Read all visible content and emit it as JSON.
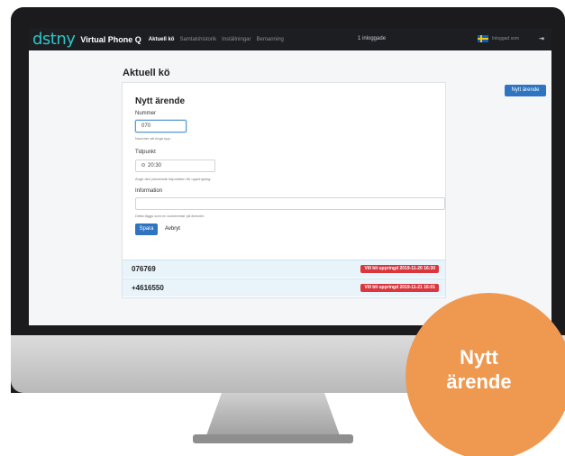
{
  "navbar": {
    "logo": "dstny",
    "product": "Virtual Phone Q",
    "tabs": [
      "Aktuell kö",
      "Samtalshistorik",
      "Inställningar",
      "Bemanning"
    ],
    "logged_in_count": "1 inloggade",
    "logged_in_as": "Inloggad som",
    "colors": {
      "background": "#1d1e22",
      "logo": "#2ec4c4"
    }
  },
  "main": {
    "page_title": "Aktuell kö",
    "new_case_button": "Nytt ärende"
  },
  "form": {
    "title": "Nytt ärende",
    "number_label": "Nummer",
    "number_value": "070",
    "number_help": "Nummer att ringa upp.",
    "time_label": "Tidpunkt",
    "time_value": "20:30",
    "time_help": "Ange den planerade tidpunkten för uppringning.",
    "info_label": "Information",
    "info_value": "",
    "info_help": "Detta läggs som en kommentar på ärendet.",
    "save_label": "Spara",
    "cancel_label": "Avbryt"
  },
  "queue": [
    {
      "number": "076769",
      "status": "Vill bli uppringd 2019-11-20 16:30"
    },
    {
      "number": "+4616550",
      "status": "Vill bli uppringd 2019-11-21 16:01"
    }
  ],
  "promo": {
    "text": "Nytt ärende",
    "color": "#ef9850"
  }
}
